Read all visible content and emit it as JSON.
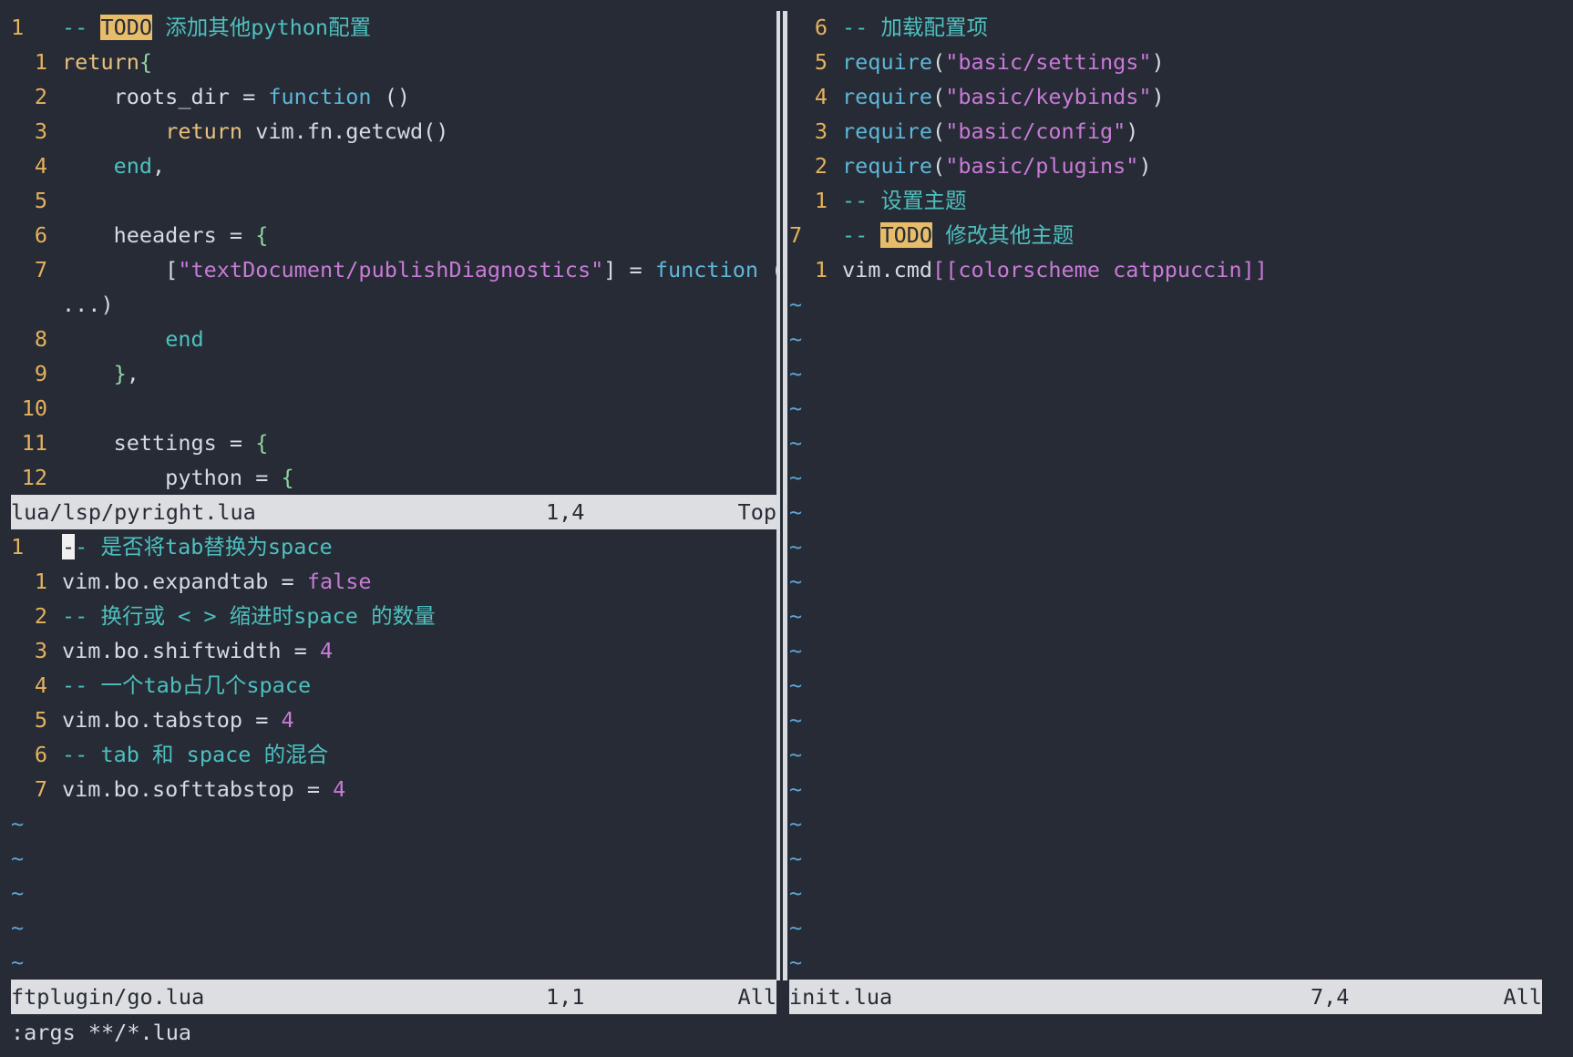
{
  "left_top": {
    "lines": [
      {
        "n": "1",
        "cur": true,
        "parts": [
          [
            "c-com",
            "-- "
          ],
          [
            "todo",
            "TODO"
          ],
          [
            "c-com",
            " 添加其他python配置"
          ]
        ]
      },
      {
        "n": "1",
        "parts": [
          [
            "c-kw",
            "return"
          ],
          [
            "c-brace",
            "{"
          ]
        ]
      },
      {
        "n": "2",
        "parts": [
          [
            "",
            "    roots_dir = "
          ],
          [
            "c-fn",
            "function"
          ],
          [
            "",
            " ()"
          ]
        ]
      },
      {
        "n": "3",
        "parts": [
          [
            "",
            "        "
          ],
          [
            "c-kw",
            "return"
          ],
          [
            "",
            " vim.fn.getcwd()"
          ]
        ]
      },
      {
        "n": "4",
        "parts": [
          [
            "",
            "    "
          ],
          [
            "c-end",
            "end"
          ],
          [
            "",
            ","
          ]
        ]
      },
      {
        "n": "5",
        "parts": []
      },
      {
        "n": "6",
        "parts": [
          [
            "",
            "    heeaders = "
          ],
          [
            "c-brace",
            "{"
          ]
        ]
      },
      {
        "n": "7",
        "parts": [
          [
            "",
            "        ["
          ],
          [
            "c-str",
            "\"textDocument/publishDiagnostics\""
          ],
          [
            "",
            "] = "
          ],
          [
            "c-fn",
            "function"
          ],
          [
            "",
            " ("
          ]
        ]
      },
      {
        "n": "",
        "parts": [
          [
            "",
            "...)"
          ]
        ]
      },
      {
        "n": "8",
        "parts": [
          [
            "",
            "        "
          ],
          [
            "c-end",
            "end"
          ]
        ]
      },
      {
        "n": "9",
        "parts": [
          [
            "",
            "    "
          ],
          [
            "c-brace",
            "}"
          ],
          [
            "",
            ","
          ]
        ]
      },
      {
        "n": "10",
        "parts": []
      },
      {
        "n": "11",
        "parts": [
          [
            "",
            "    settings = "
          ],
          [
            "c-brace",
            "{"
          ]
        ]
      },
      {
        "n": "12",
        "parts": [
          [
            "",
            "        python = "
          ],
          [
            "c-brace",
            "{"
          ]
        ]
      }
    ],
    "status": {
      "file": "lua/lsp/pyright.lua",
      "pos": "1,4",
      "scroll": "Top"
    }
  },
  "left_bottom": {
    "lines": [
      {
        "n": "1",
        "cur": true,
        "cursor": true,
        "parts": [
          [
            "c-com",
            "- 是否将tab替换为space"
          ]
        ]
      },
      {
        "n": "1",
        "parts": [
          [
            "",
            "vim.bo.expandtab = "
          ],
          [
            "c-bool",
            "false"
          ]
        ]
      },
      {
        "n": "2",
        "parts": [
          [
            "c-com",
            "-- 换行或 < > 缩进时space 的数量"
          ]
        ]
      },
      {
        "n": "3",
        "parts": [
          [
            "",
            "vim.bo.shiftwidth = "
          ],
          [
            "c-num",
            "4"
          ]
        ]
      },
      {
        "n": "4",
        "parts": [
          [
            "c-com",
            "-- 一个tab占几个space"
          ]
        ]
      },
      {
        "n": "5",
        "parts": [
          [
            "",
            "vim.bo.tabstop = "
          ],
          [
            "c-num",
            "4"
          ]
        ]
      },
      {
        "n": "6",
        "parts": [
          [
            "c-com",
            "-- tab 和 space 的混合"
          ]
        ]
      },
      {
        "n": "7",
        "parts": [
          [
            "",
            "vim.bo.softtabstop = "
          ],
          [
            "c-num",
            "4"
          ]
        ]
      }
    ],
    "tildes": 5,
    "status": {
      "file": "ftplugin/go.lua",
      "pos": "1,1",
      "scroll": "All"
    }
  },
  "right": {
    "lines": [
      {
        "n": "6",
        "parts": [
          [
            "c-com",
            "-- 加载配置项"
          ]
        ]
      },
      {
        "n": "5",
        "parts": [
          [
            "c-fn",
            "require"
          ],
          [
            "",
            "("
          ],
          [
            "c-str",
            "\"basic/settings\""
          ],
          [
            "",
            ")"
          ]
        ]
      },
      {
        "n": "4",
        "parts": [
          [
            "c-fn",
            "require"
          ],
          [
            "",
            "("
          ],
          [
            "c-str",
            "\"basic/keybinds\""
          ],
          [
            "",
            ")"
          ]
        ]
      },
      {
        "n": "3",
        "parts": [
          [
            "c-fn",
            "require"
          ],
          [
            "",
            "("
          ],
          [
            "c-str",
            "\"basic/config\""
          ],
          [
            "",
            ")"
          ]
        ]
      },
      {
        "n": "2",
        "parts": [
          [
            "c-fn",
            "require"
          ],
          [
            "",
            "("
          ],
          [
            "c-str",
            "\"basic/plugins\""
          ],
          [
            "",
            ")"
          ]
        ]
      },
      {
        "n": "1",
        "parts": [
          [
            "c-com",
            "-- 设置主题"
          ]
        ]
      },
      {
        "n": "7",
        "cur": true,
        "parts": [
          [
            "c-com",
            "-- "
          ],
          [
            "todo",
            "TODO"
          ],
          [
            "c-com",
            " 修改其他主题"
          ]
        ]
      },
      {
        "n": "1",
        "parts": [
          [
            "",
            "vim.cmd"
          ],
          [
            "c-str",
            "[[colorscheme catppuccin]]"
          ]
        ]
      }
    ],
    "tildes": 20,
    "status": {
      "file": "init.lua",
      "pos": "7,4",
      "scroll": "All"
    }
  },
  "cmdline": ":args **/*.lua"
}
